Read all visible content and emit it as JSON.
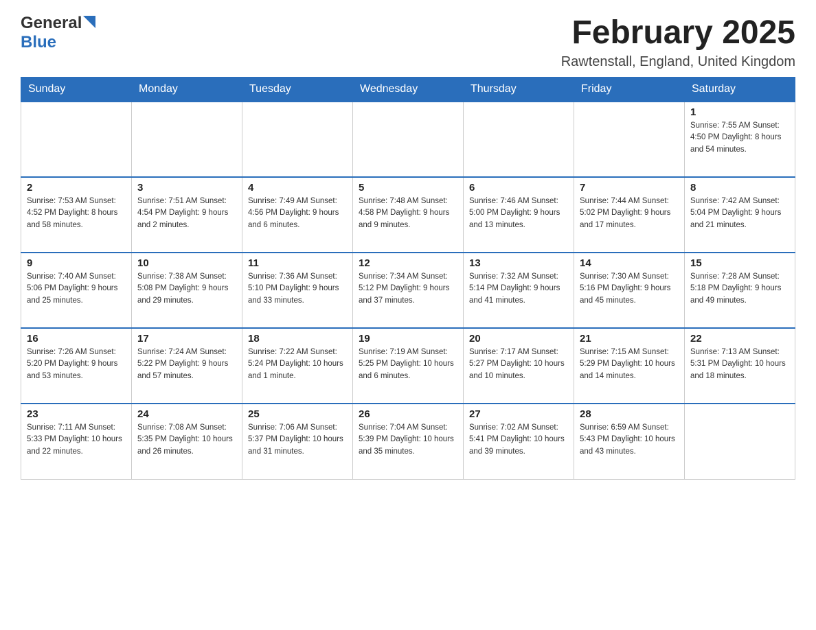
{
  "header": {
    "logo_general": "General",
    "logo_blue": "Blue",
    "month_year": "February 2025",
    "location": "Rawtenstall, England, United Kingdom"
  },
  "weekdays": [
    "Sunday",
    "Monday",
    "Tuesday",
    "Wednesday",
    "Thursday",
    "Friday",
    "Saturday"
  ],
  "weeks": [
    [
      {
        "day": "",
        "info": ""
      },
      {
        "day": "",
        "info": ""
      },
      {
        "day": "",
        "info": ""
      },
      {
        "day": "",
        "info": ""
      },
      {
        "day": "",
        "info": ""
      },
      {
        "day": "",
        "info": ""
      },
      {
        "day": "1",
        "info": "Sunrise: 7:55 AM\nSunset: 4:50 PM\nDaylight: 8 hours\nand 54 minutes."
      }
    ],
    [
      {
        "day": "2",
        "info": "Sunrise: 7:53 AM\nSunset: 4:52 PM\nDaylight: 8 hours\nand 58 minutes."
      },
      {
        "day": "3",
        "info": "Sunrise: 7:51 AM\nSunset: 4:54 PM\nDaylight: 9 hours\nand 2 minutes."
      },
      {
        "day": "4",
        "info": "Sunrise: 7:49 AM\nSunset: 4:56 PM\nDaylight: 9 hours\nand 6 minutes."
      },
      {
        "day": "5",
        "info": "Sunrise: 7:48 AM\nSunset: 4:58 PM\nDaylight: 9 hours\nand 9 minutes."
      },
      {
        "day": "6",
        "info": "Sunrise: 7:46 AM\nSunset: 5:00 PM\nDaylight: 9 hours\nand 13 minutes."
      },
      {
        "day": "7",
        "info": "Sunrise: 7:44 AM\nSunset: 5:02 PM\nDaylight: 9 hours\nand 17 minutes."
      },
      {
        "day": "8",
        "info": "Sunrise: 7:42 AM\nSunset: 5:04 PM\nDaylight: 9 hours\nand 21 minutes."
      }
    ],
    [
      {
        "day": "9",
        "info": "Sunrise: 7:40 AM\nSunset: 5:06 PM\nDaylight: 9 hours\nand 25 minutes."
      },
      {
        "day": "10",
        "info": "Sunrise: 7:38 AM\nSunset: 5:08 PM\nDaylight: 9 hours\nand 29 minutes."
      },
      {
        "day": "11",
        "info": "Sunrise: 7:36 AM\nSunset: 5:10 PM\nDaylight: 9 hours\nand 33 minutes."
      },
      {
        "day": "12",
        "info": "Sunrise: 7:34 AM\nSunset: 5:12 PM\nDaylight: 9 hours\nand 37 minutes."
      },
      {
        "day": "13",
        "info": "Sunrise: 7:32 AM\nSunset: 5:14 PM\nDaylight: 9 hours\nand 41 minutes."
      },
      {
        "day": "14",
        "info": "Sunrise: 7:30 AM\nSunset: 5:16 PM\nDaylight: 9 hours\nand 45 minutes."
      },
      {
        "day": "15",
        "info": "Sunrise: 7:28 AM\nSunset: 5:18 PM\nDaylight: 9 hours\nand 49 minutes."
      }
    ],
    [
      {
        "day": "16",
        "info": "Sunrise: 7:26 AM\nSunset: 5:20 PM\nDaylight: 9 hours\nand 53 minutes."
      },
      {
        "day": "17",
        "info": "Sunrise: 7:24 AM\nSunset: 5:22 PM\nDaylight: 9 hours\nand 57 minutes."
      },
      {
        "day": "18",
        "info": "Sunrise: 7:22 AM\nSunset: 5:24 PM\nDaylight: 10 hours\nand 1 minute."
      },
      {
        "day": "19",
        "info": "Sunrise: 7:19 AM\nSunset: 5:25 PM\nDaylight: 10 hours\nand 6 minutes."
      },
      {
        "day": "20",
        "info": "Sunrise: 7:17 AM\nSunset: 5:27 PM\nDaylight: 10 hours\nand 10 minutes."
      },
      {
        "day": "21",
        "info": "Sunrise: 7:15 AM\nSunset: 5:29 PM\nDaylight: 10 hours\nand 14 minutes."
      },
      {
        "day": "22",
        "info": "Sunrise: 7:13 AM\nSunset: 5:31 PM\nDaylight: 10 hours\nand 18 minutes."
      }
    ],
    [
      {
        "day": "23",
        "info": "Sunrise: 7:11 AM\nSunset: 5:33 PM\nDaylight: 10 hours\nand 22 minutes."
      },
      {
        "day": "24",
        "info": "Sunrise: 7:08 AM\nSunset: 5:35 PM\nDaylight: 10 hours\nand 26 minutes."
      },
      {
        "day": "25",
        "info": "Sunrise: 7:06 AM\nSunset: 5:37 PM\nDaylight: 10 hours\nand 31 minutes."
      },
      {
        "day": "26",
        "info": "Sunrise: 7:04 AM\nSunset: 5:39 PM\nDaylight: 10 hours\nand 35 minutes."
      },
      {
        "day": "27",
        "info": "Sunrise: 7:02 AM\nSunset: 5:41 PM\nDaylight: 10 hours\nand 39 minutes."
      },
      {
        "day": "28",
        "info": "Sunrise: 6:59 AM\nSunset: 5:43 PM\nDaylight: 10 hours\nand 43 minutes."
      },
      {
        "day": "",
        "info": ""
      }
    ]
  ]
}
